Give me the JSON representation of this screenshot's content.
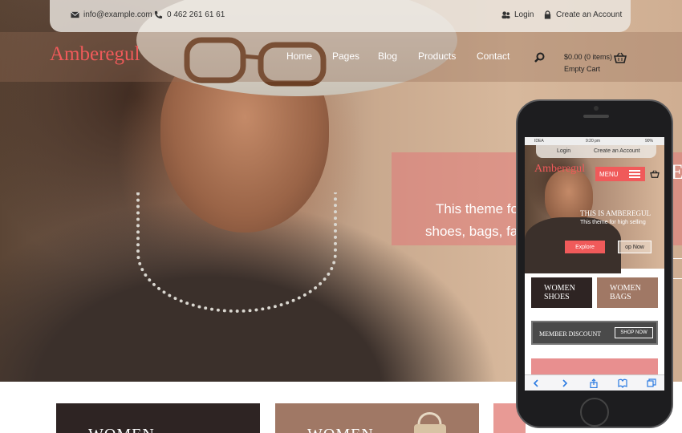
{
  "topbar": {
    "email": "info@example.com",
    "phone": "0 462 261 61 61",
    "login": "Login",
    "create_account": "Create an Account"
  },
  "brand": {
    "logo": "Amberegul",
    "accent": "#f05a5a"
  },
  "nav": {
    "items": [
      "Home",
      "Pages",
      "Blog",
      "Products",
      "Contact"
    ]
  },
  "cart": {
    "amount": "$0.00 (0 items)",
    "status": "Empty Cart"
  },
  "slider": {
    "line1": "This theme fo",
    "line2": "shoes, bags, fas",
    "heading_fragment": "E"
  },
  "categories": [
    {
      "title": "WOMEN",
      "color": "#2e2423"
    },
    {
      "title": "WOMEN",
      "color": "#a07865"
    },
    {
      "title": "",
      "color": "#e89a95"
    }
  ],
  "mobile": {
    "carrier": "IDEA",
    "time": "9:20 pm",
    "battery": "90%",
    "login": "Login",
    "create_account": "Create an Account",
    "logo": "Amberegul",
    "menu_label": "MENU",
    "slide_title": "THIS IS AMBEREGUL",
    "slide_sub": "This theme for high selling",
    "explore": "Explore",
    "shop_now_fragment": "op Now",
    "card1": "WOMEN SHOES",
    "card2": "WOMEN BAGS",
    "member_discount": "MEMBER DISCOUNT",
    "shop_now": "SHOP NOW"
  }
}
